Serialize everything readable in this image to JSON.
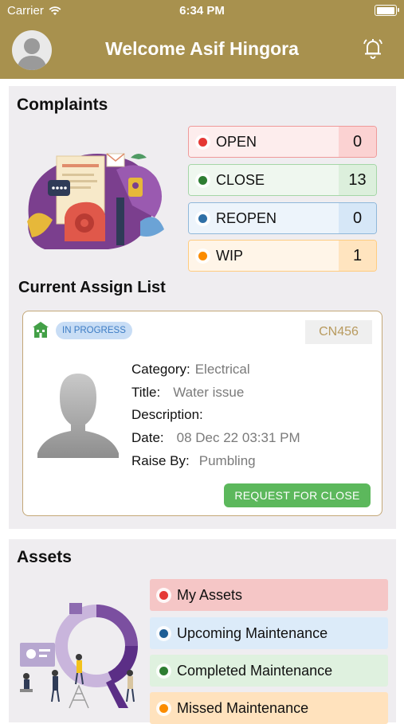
{
  "status_bar": {
    "carrier": "Carrier",
    "time": "6:34 PM"
  },
  "header": {
    "title": "Welcome Asif Hingora"
  },
  "complaints": {
    "title": "Complaints",
    "items": [
      {
        "label": "OPEN",
        "count": "0",
        "dot": "#E53935",
        "border": "#EF9A9A",
        "bg": "#FDEDED",
        "count_bg": "#FBD2D2"
      },
      {
        "label": "CLOSE",
        "count": "13",
        "dot": "#2E7D32",
        "border": "#A5D6A7",
        "bg": "#EFF7EF",
        "count_bg": "#DCEFDC"
      },
      {
        "label": "REOPEN",
        "count": "0",
        "dot": "#2E6FA6",
        "border": "#90B8DA",
        "bg": "#EDF4FB",
        "count_bg": "#D6E7F7"
      },
      {
        "label": "WIP",
        "count": "1",
        "dot": "#FB8C00",
        "border": "#FFCC80",
        "bg": "#FFF5E8",
        "count_bg": "#FFE4BF"
      }
    ]
  },
  "assign": {
    "title": "Current Assign List",
    "status_badge": "IN PROGRESS",
    "complaint_no": "CN456",
    "fields": {
      "category_label": "Category:",
      "category": "Electrical",
      "title_label": "Title:",
      "title": "Water issue",
      "description_label": "Description:",
      "description": "",
      "date_label": "Date:",
      "date": "08 Dec 22 03:31 PM",
      "raise_label": "Raise By:",
      "raise": "Pumbling"
    },
    "button": "REQUEST FOR CLOSE"
  },
  "assets": {
    "title": "Assets",
    "items": [
      {
        "label": "My Assets",
        "dot": "#E53935",
        "bg": "#F5C6C6"
      },
      {
        "label": "Upcoming Maintenance",
        "dot": "#1F5F96",
        "bg": "#DCEBF9"
      },
      {
        "label": "Completed Maintenance",
        "dot": "#2E7D32",
        "bg": "#DFF1DF"
      },
      {
        "label": "Missed Maintenance",
        "dot": "#FB8C00",
        "bg": "#FFE2BD"
      }
    ]
  },
  "colors": {
    "brand": "#A8914E",
    "card_bg": "#EFEDF0",
    "accent_button": "#5CB85C"
  }
}
